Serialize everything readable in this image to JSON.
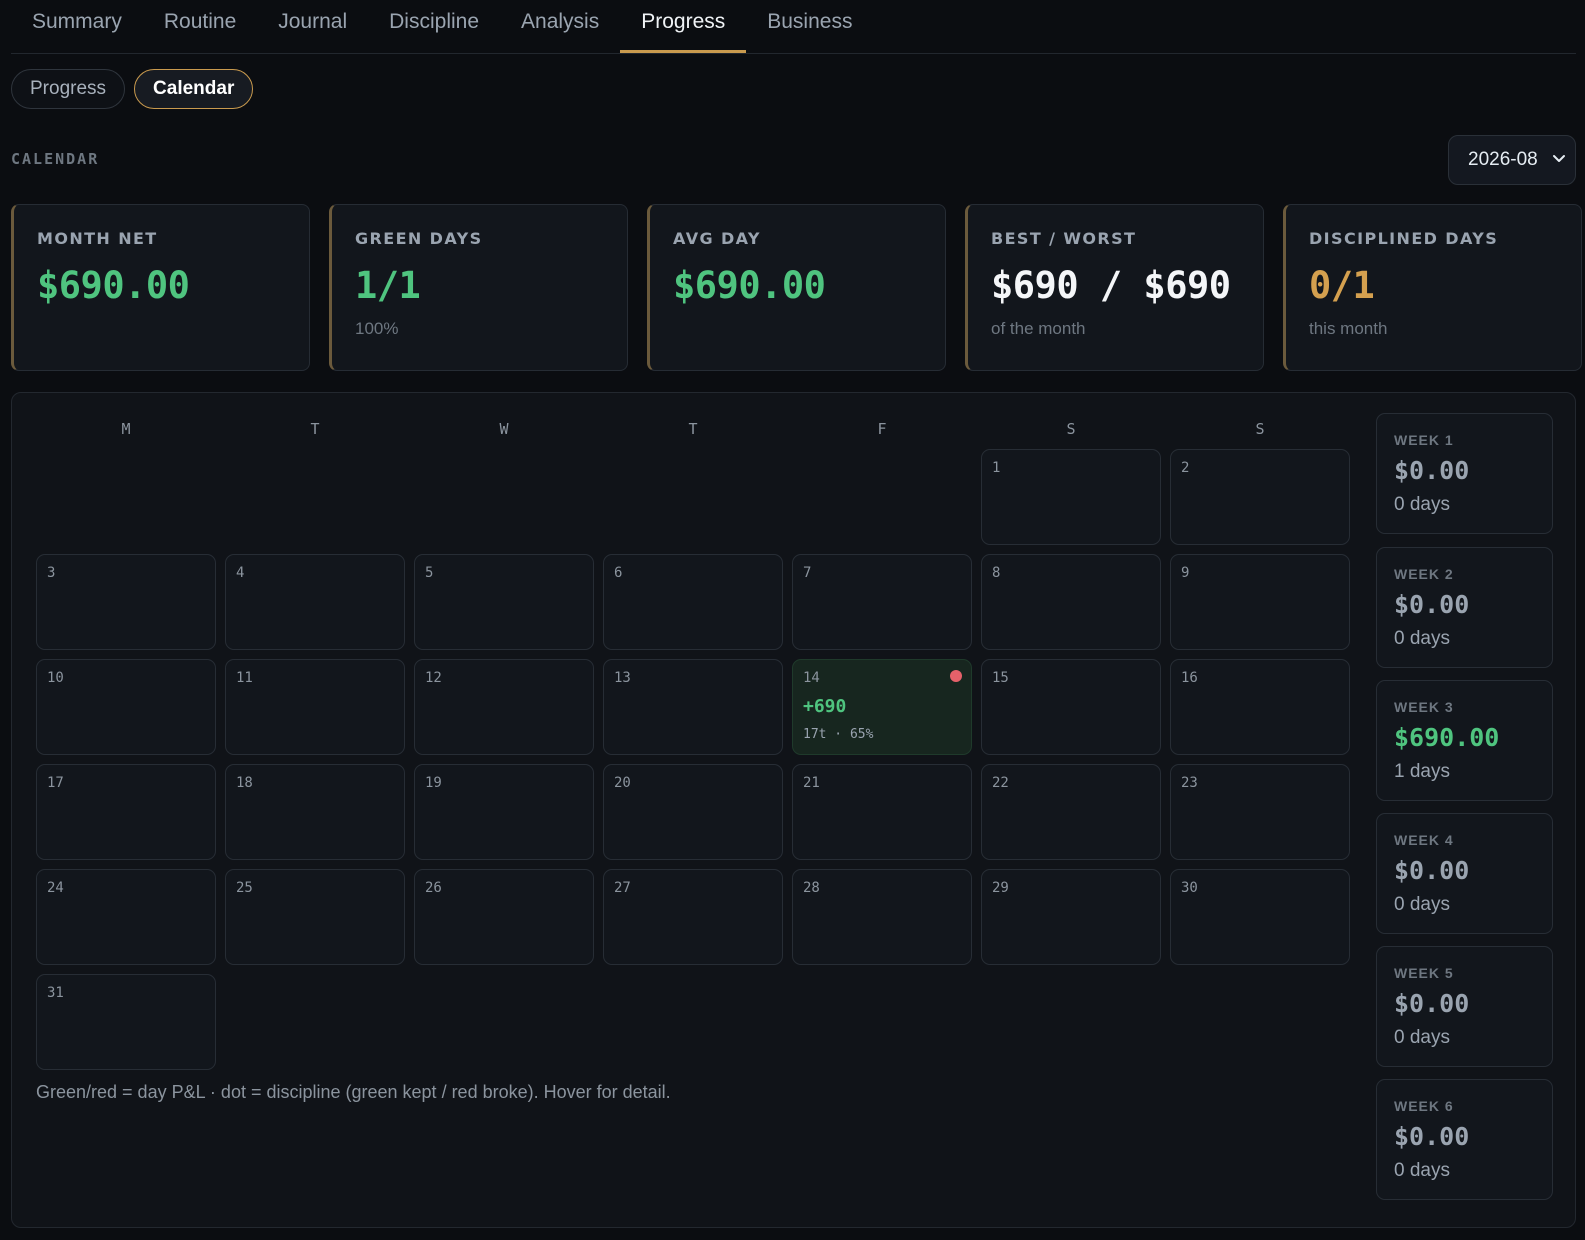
{
  "nav": {
    "tabs": [
      "Summary",
      "Routine",
      "Journal",
      "Discipline",
      "Analysis",
      "Progress",
      "Business"
    ],
    "active": "Progress"
  },
  "subtabs": {
    "items": [
      "Progress",
      "Calendar"
    ],
    "active": "Calendar"
  },
  "calendar": {
    "section_title": "CALENDAR",
    "month_select": "2026-08",
    "cards": {
      "month_net": {
        "label": "MONTH NET",
        "value": "$690.00",
        "sub": ""
      },
      "green_days": {
        "label": "GREEN DAYS",
        "value": "1/1",
        "sub": "100%"
      },
      "avg_day": {
        "label": "AVG DAY",
        "value": "$690.00",
        "sub": ""
      },
      "best_worst": {
        "label": "BEST / WORST",
        "value": "$690 / $690",
        "sub": "of the month"
      },
      "disciplined": {
        "label": "DISCIPLINED DAYS",
        "value": "0/1",
        "sub": "this month"
      }
    },
    "weekdays": [
      "M",
      "T",
      "W",
      "T",
      "F",
      "S",
      "S"
    ],
    "first_weekday_index": 5,
    "days_in_month": 31,
    "day_entries": {
      "14": {
        "pnl": "+690",
        "meta": "17t · 65%",
        "discipline": "broke",
        "positive": true
      }
    },
    "weeks": [
      {
        "label": "WEEK 1",
        "value": "$0.00",
        "days": "0 days",
        "positive": false
      },
      {
        "label": "WEEK 2",
        "value": "$0.00",
        "days": "0 days",
        "positive": false
      },
      {
        "label": "WEEK 3",
        "value": "$690.00",
        "days": "1 days",
        "positive": true
      },
      {
        "label": "WEEK 4",
        "value": "$0.00",
        "days": "0 days",
        "positive": false
      },
      {
        "label": "WEEK 5",
        "value": "$0.00",
        "days": "0 days",
        "positive": false
      },
      {
        "label": "WEEK 6",
        "value": "$0.00",
        "days": "0 days",
        "positive": false
      }
    ],
    "legend": "Green/red = day P&L · dot = discipline (green kept / red broke). Hover for detail."
  },
  "colors": {
    "background": "#0b0d11",
    "accent": "#c99a4e",
    "positive": "#4fc47f",
    "negative": "#e5616a",
    "amber": "#d4a04f"
  }
}
